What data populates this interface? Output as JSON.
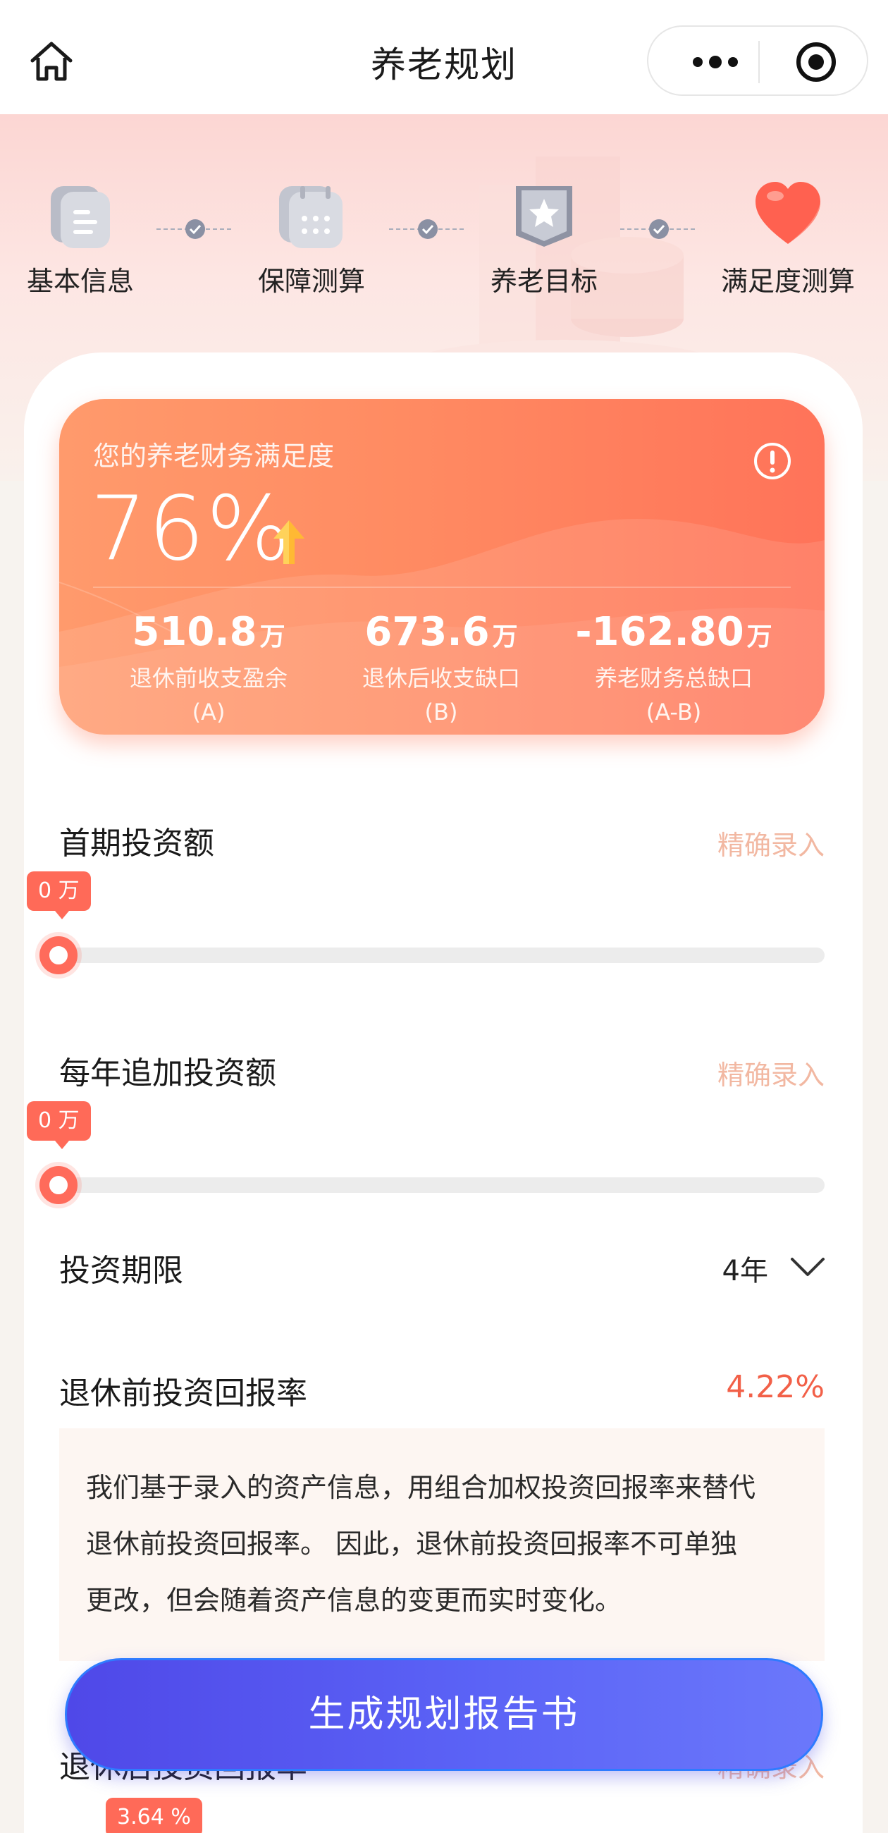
{
  "nav": {
    "title": "养老规划",
    "home_icon": "home-icon",
    "more_icon": "more-dots-icon",
    "close_icon": "target-circle-icon"
  },
  "steps": [
    {
      "label": "基本信息",
      "icon": "document-icon"
    },
    {
      "label": "保障测算",
      "icon": "calendar-icon"
    },
    {
      "label": "养老目标",
      "icon": "star-badge-icon"
    },
    {
      "label": "满足度测算",
      "icon": "heart-icon"
    }
  ],
  "score": {
    "subtitle": "您的养老财务满足度",
    "percent": "76%",
    "metrics": [
      {
        "value": "510.8",
        "unit": "万",
        "caption": "退休前收支盈余",
        "sub": "(A)"
      },
      {
        "value": "673.6",
        "unit": "万",
        "caption": "退休后收支缺口",
        "sub": "(B)"
      },
      {
        "value": "-162.80",
        "unit": "万",
        "caption": "养老财务总缺口",
        "sub": "(A-B)"
      }
    ]
  },
  "initial_investment": {
    "title": "首期投资额",
    "action": "精确录入",
    "tip": "0 万",
    "level": 0
  },
  "annual_investment": {
    "title": "每年追加投资额",
    "action": "精确录入",
    "tip": "0 万",
    "level": 0
  },
  "period": {
    "title": "投资期限",
    "value": "4年"
  },
  "pre_retire_rate": {
    "title": "退休前投资回报率",
    "value": "4.22%"
  },
  "note": {
    "line1": "我们基于录入的资产信息，用组合加权投资回报率来替代",
    "line2": "退休前投资回报率。 因此，退休前投资回报率不可单独",
    "line3": "更改，但会随着资产信息的变更而实时变化。"
  },
  "post_retire_rate": {
    "title": "退休后投资回报率",
    "action": "精确录入",
    "tip": "3.64 %"
  },
  "cta": {
    "label": "生成规划报告书"
  },
  "colors": {
    "accent": "#ff6b5b",
    "cta_start": "#4f48e8",
    "cta_end": "#6b78fb"
  }
}
